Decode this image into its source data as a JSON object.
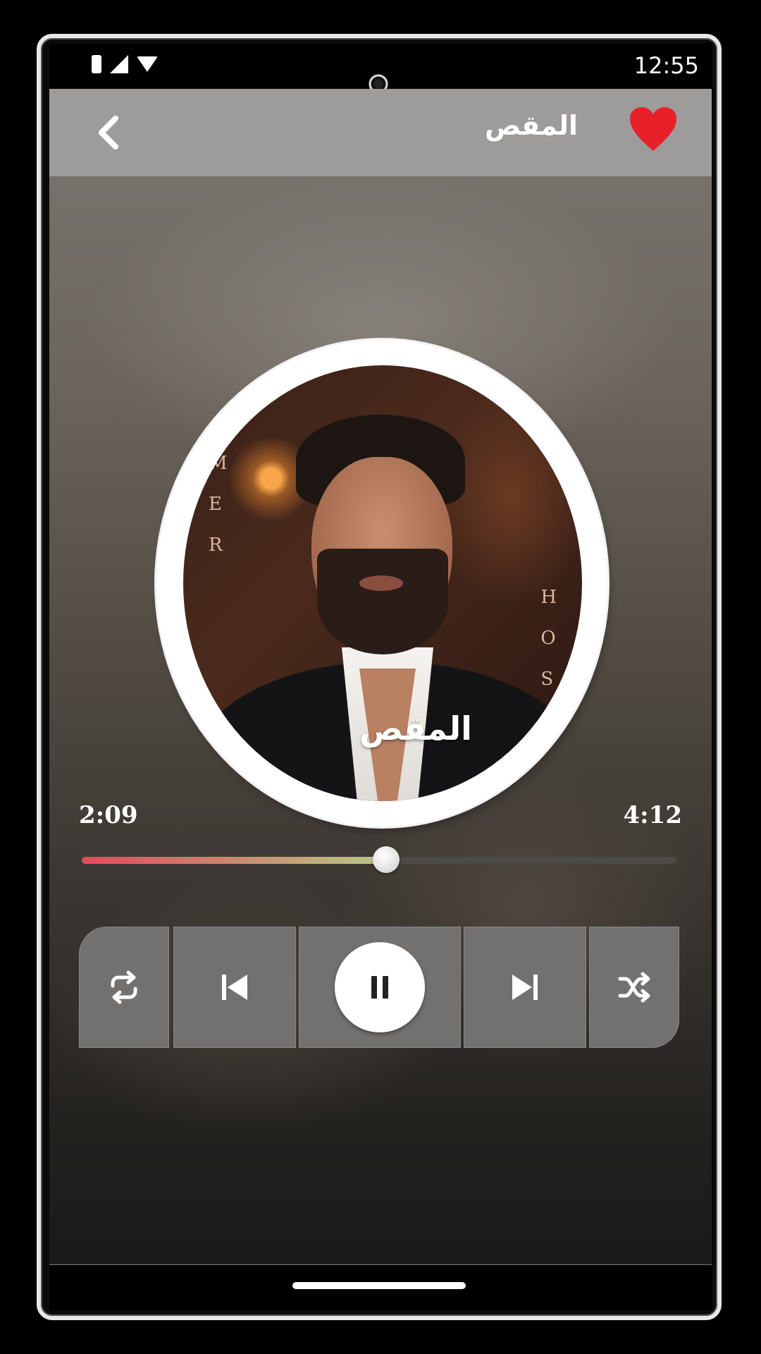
{
  "status_bar": {
    "time": "12:55",
    "icons": [
      "battery-icon",
      "signal-icon",
      "wifi-icon"
    ]
  },
  "header": {
    "title": "المقص",
    "back_icon": "chevron-left-icon",
    "favorite_icon": "heart-icon",
    "favorite_color": "#e8202a"
  },
  "album_art": {
    "lettering_left": [
      "M",
      "E",
      "R"
    ],
    "lettering_right": [
      "H",
      "O",
      "S"
    ]
  },
  "player": {
    "song_title": "المقص",
    "current_time": "2:09",
    "total_time": "4:12",
    "progress_fraction": 0.512,
    "progress_colors": [
      "#e34a5c",
      "#b9c987"
    ]
  },
  "controls": {
    "repeat_icon": "repeat-icon",
    "previous_icon": "skip-previous-icon",
    "play_pause_icon": "pause-icon",
    "next_icon": "skip-next-icon",
    "shuffle_icon": "shuffle-icon"
  }
}
